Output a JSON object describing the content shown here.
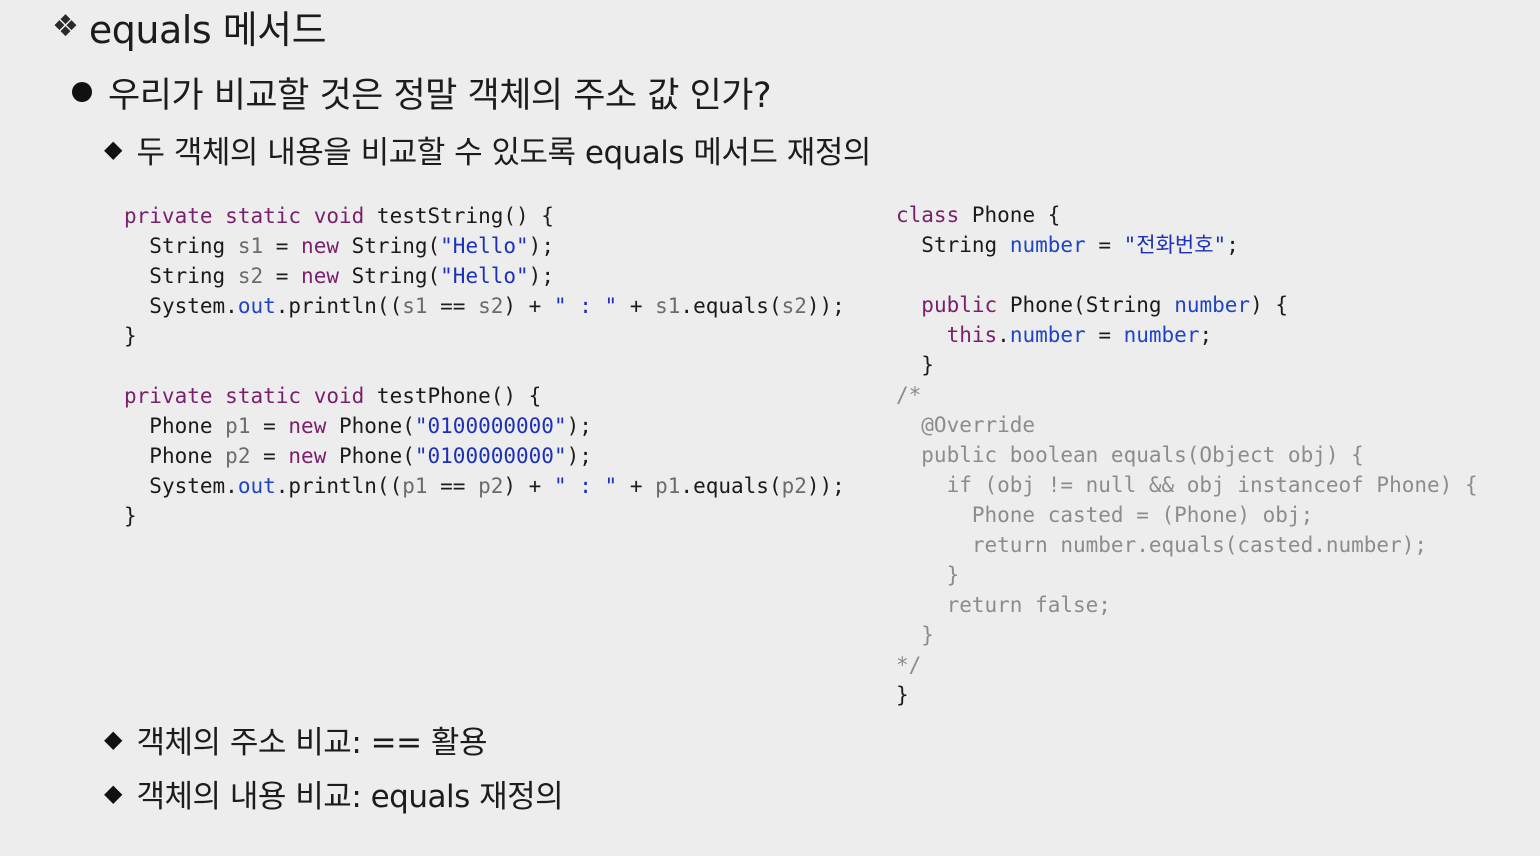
{
  "slide": {
    "title": "equals 메서드",
    "title_icon": "four-diamond-bullet-icon",
    "bullet": "우리가 비교할 것은 정말 객체의 주소 값 인가?",
    "sub_bullets": [
      "두 객체의 내용을 비교할 수 있도록 equals 메서드 재정의",
      "객체의 주소 비교: == 활용",
      "객체의 내용 비교: equals 재정의"
    ]
  },
  "code_left": [
    "private static void testString() {",
    "  String s1 = new String(\"Hello\");",
    "  String s2 = new String(\"Hello\");",
    "  System.out.println((s1 == s2) + \" : \" + s1.equals(s2));",
    "}",
    "",
    "private static void testPhone() {",
    "  Phone p1 = new Phone(\"0100000000\");",
    "  Phone p2 = new Phone(\"0100000000\");",
    "  System.out.println((p1 == p2) + \" : \" + p1.equals(p2));",
    "}"
  ],
  "code_right": [
    "class Phone {",
    "  String number = \"전화번호\";",
    "",
    "  public Phone(String number) {",
    "    this.number = number;",
    "  }",
    "/*",
    "  @Override",
    "  public boolean equals(Object obj) {",
    "    if (obj != null && obj instanceof Phone) {",
    "      Phone casted = (Phone) obj;",
    "      return number.equals(casted.number);",
    "    }",
    "    return false;",
    "  }",
    "*/",
    "}"
  ],
  "colors": {
    "background": "#ededed",
    "keyword": "#7a1f6b",
    "field": "#1f45c7",
    "string": "#1d31b8",
    "variable": "#6b6b6b",
    "comment": "#8c8c8c"
  }
}
